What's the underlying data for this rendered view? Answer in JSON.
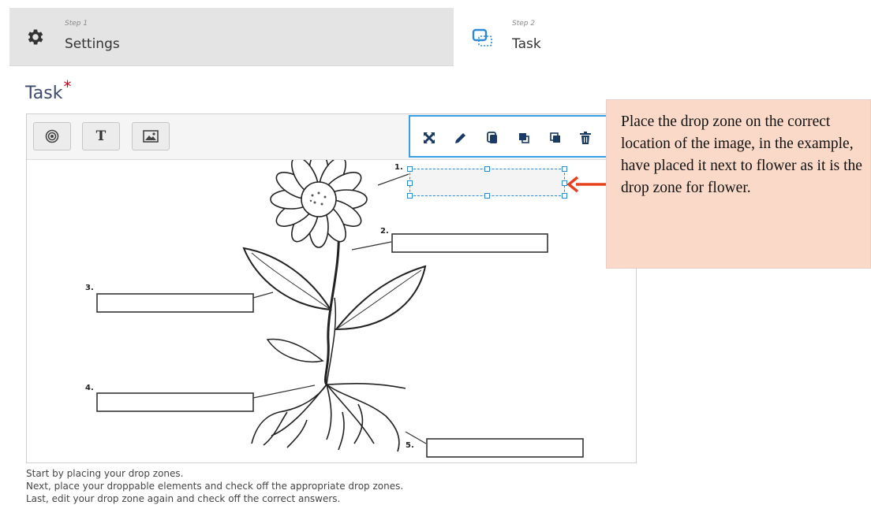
{
  "steps": [
    {
      "small": "Step 1",
      "label": "Settings",
      "icon": "gear-icon"
    },
    {
      "small": "Step 2",
      "label": "Task",
      "icon": "drop-zone-icon"
    }
  ],
  "task": {
    "heading": "Task",
    "required_mark": "*"
  },
  "toolbar": {
    "button_text_label": "T",
    "buttons": [
      "drop-zone-icon",
      "text-icon",
      "image-icon"
    ]
  },
  "drop_zone_toolbar": {
    "icons": [
      "move-icon",
      "edit-icon",
      "copy-icon",
      "send-to-front-icon",
      "send-to-back-icon",
      "delete-icon"
    ]
  },
  "diagram": {
    "labels": [
      "1.",
      "2.",
      "3.",
      "4.",
      "5."
    ]
  },
  "callout": {
    "text": "Place the drop zone on the correct location of the image, in the example, have placed it next to flower as it is the drop zone for flower."
  },
  "instructions": [
    "Start by placing your drop zones.",
    "Next, place your droppable elements and check off the appropriate drop zones.",
    "Last, edit your drop zone again and check off the correct answers."
  ],
  "colors": {
    "accent": "#3aa0e6",
    "callout_bg": "#fad9c8",
    "arrow": "#e8401f",
    "heading": "#3d4a6d",
    "required": "#d0021b"
  }
}
